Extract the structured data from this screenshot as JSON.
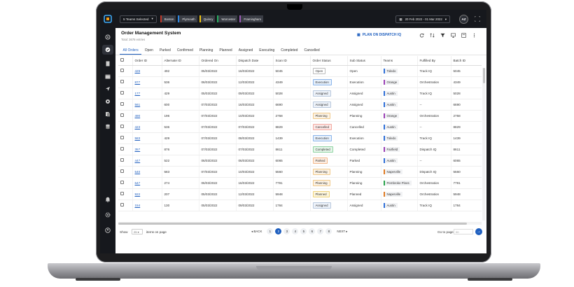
{
  "topbar": {
    "team_selector": "5 Teams Selected",
    "chips": [
      {
        "label": "Boston",
        "color": "#c0392b"
      },
      {
        "label": "Plymouth",
        "color": "#2e86de"
      },
      {
        "label": "Quincy",
        "color": "#f1c40f"
      },
      {
        "label": "Worcester",
        "color": "#27ae60"
      },
      {
        "label": "Framingham",
        "color": "#9b59b6"
      }
    ],
    "date_range": "20 Feb 2022 - 01 Mar 2022",
    "avatar": "AZ"
  },
  "page": {
    "title": "Order Management System",
    "subtitle": "Total: 3678 entries",
    "plan_button": "PLAN ON DISPATCH IQ"
  },
  "tabs": [
    "All Orders",
    "Open",
    "Parked",
    "Confirmed",
    "Planning",
    "Planned",
    "Assigned",
    "Executing",
    "Completed",
    "Cancelled"
  ],
  "columns": [
    "Order ID",
    "Alternate ID",
    "Ordered On",
    "Dispatch Date",
    "Scan ID",
    "Order Status",
    "Sub Status",
    "Teams",
    "Fulfilled By",
    "Batch ID"
  ],
  "status_colors": {
    "Open": {
      "bg": "#ffffff",
      "border": "#bbbbbb"
    },
    "Execution": {
      "bg": "#e6f0fc",
      "border": "#8ab4ea"
    },
    "Assigned": {
      "bg": "#eef3fa",
      "border": "#b9c8dd"
    },
    "Planning": {
      "bg": "#fdf3e4",
      "border": "#f0c98a"
    },
    "Cancelled": {
      "bg": "#fde8e6",
      "border": "#f2a9a1"
    },
    "Completed": {
      "bg": "#e6f6ea",
      "border": "#8fd3a2"
    },
    "Parked": {
      "bg": "#fdeee2",
      "border": "#f2b98c"
    },
    "Planned": {
      "bg": "#fdf6dc",
      "border": "#eed27a"
    }
  },
  "team_colors": {
    "Toledo": "#2e6fd8",
    "Orange": "#9b3fb5",
    "Austin": "#2e6fd8",
    "Fairfield": "#9b3fb5",
    "Naperville": "#e07b22",
    "Pembroke Pines": "#27a34a"
  },
  "rows": [
    {
      "order_id": "429",
      "alt_id": "492",
      "ordered_on": "05/03/2022",
      "dispatch": "16/03/2022",
      "scan_id": "5045",
      "status": "Open",
      "sub_status": "Open",
      "team": "Toledo",
      "fulfilled": "Track IQ",
      "batch": "5045"
    },
    {
      "order_id": "877",
      "alt_id": "536",
      "ordered_on": "06/03/2022",
      "dispatch": "12/03/2022",
      "scan_id": "4349",
      "status": "Execution",
      "sub_status": "Execution",
      "team": "Orange",
      "fulfilled": "Orchestration",
      "batch": "4349"
    },
    {
      "order_id": "177",
      "alt_id": "429",
      "ordered_on": "05/03/2022",
      "dispatch": "09/03/2022",
      "scan_id": "5028",
      "status": "Assigned",
      "sub_status": "Assigned",
      "team": "Austin",
      "fulfilled": "Track IQ",
      "batch": "5028"
    },
    {
      "order_id": "561",
      "alt_id": "600",
      "ordered_on": "07/03/2022",
      "dispatch": "16/03/2022",
      "scan_id": "6690",
      "status": "Assigned",
      "sub_status": "Assigned",
      "team": "Austin",
      "fulfilled": "--",
      "batch": "6690"
    },
    {
      "order_id": "490",
      "alt_id": "196",
      "ordered_on": "07/03/2022",
      "dispatch": "10/03/2022",
      "scan_id": "2758",
      "status": "Planning",
      "sub_status": "Planning",
      "team": "Orange",
      "fulfilled": "Orchestration",
      "batch": "2758"
    },
    {
      "order_id": "423",
      "alt_id": "536",
      "ordered_on": "07/03/2022",
      "dispatch": "07/03/2022",
      "scan_id": "8829",
      "status": "Cancelled",
      "sub_status": "Cancelled",
      "team": "Austin",
      "fulfilled": "--",
      "batch": "8829"
    },
    {
      "order_id": "583",
      "alt_id": "429",
      "ordered_on": "07/03/2022",
      "dispatch": "08/03/2022",
      "scan_id": "1439",
      "status": "Execution",
      "sub_status": "Execution",
      "team": "Toledo",
      "fulfilled": "Track IQ",
      "batch": "1439"
    },
    {
      "order_id": "357",
      "alt_id": "876",
      "ordered_on": "07/03/2022",
      "dispatch": "07/03/2022",
      "scan_id": "8611",
      "status": "Completed",
      "sub_status": "Completed",
      "team": "Fairfield",
      "fulfilled": "Dispatch IQ",
      "batch": "8611"
    },
    {
      "order_id": "447",
      "alt_id": "522",
      "ordered_on": "06/03/2022",
      "dispatch": "06/03/2022",
      "scan_id": "6065",
      "status": "Parked",
      "sub_status": "Parked",
      "team": "Austin",
      "fulfilled": "--",
      "batch": "6065"
    },
    {
      "order_id": "540",
      "alt_id": "583",
      "ordered_on": "07/03/2022",
      "dispatch": "10/03/2022",
      "scan_id": "5560",
      "status": "Planning",
      "sub_status": "Planning",
      "team": "Naperville",
      "fulfilled": "Dispatch IQ",
      "batch": "5560"
    },
    {
      "order_id": "647",
      "alt_id": "274",
      "ordered_on": "06/03/2022",
      "dispatch": "16/03/2022",
      "scan_id": "7791",
      "status": "Planning",
      "sub_status": "Planning",
      "team": "Pembroke Pines",
      "fulfilled": "Orchestration",
      "batch": "7791"
    },
    {
      "order_id": "922",
      "alt_id": "207",
      "ordered_on": "05/03/2022",
      "dispatch": "12/03/2022",
      "scan_id": "5948",
      "status": "Planned",
      "sub_status": "Planned",
      "team": "Naperville",
      "fulfilled": "Orchestration",
      "batch": "5948"
    },
    {
      "order_id": "154",
      "alt_id": "130",
      "ordered_on": "05/03/2022",
      "dispatch": "09/03/2022",
      "scan_id": "1784",
      "status": "Assigned",
      "sub_status": "Assigned",
      "team": "Austin",
      "fulfilled": "Track IQ",
      "batch": "1784"
    }
  ],
  "footer": {
    "show_label": "Show",
    "show_value": "25",
    "items_label": "items on page",
    "back": "BACK",
    "next": "NEXT",
    "pages": [
      "1",
      "2",
      "3",
      "4",
      "5",
      "6",
      "7",
      "8"
    ],
    "active_page": "2",
    "goto_label": "Go to page",
    "goto_placeholder": "00"
  },
  "icons": {
    "nav": [
      "hex-logo-icon",
      "dashboard-icon",
      "orders-icon",
      "calendar-icon",
      "navigation-icon",
      "settings-gear-icon",
      "documents-icon",
      "layers-icon",
      "bell-icon",
      "cog-icon",
      "user-circle-icon"
    ],
    "tools": [
      "refresh-icon",
      "sort-icon",
      "filter-icon",
      "columns-icon",
      "download-icon",
      "more-icon"
    ]
  }
}
